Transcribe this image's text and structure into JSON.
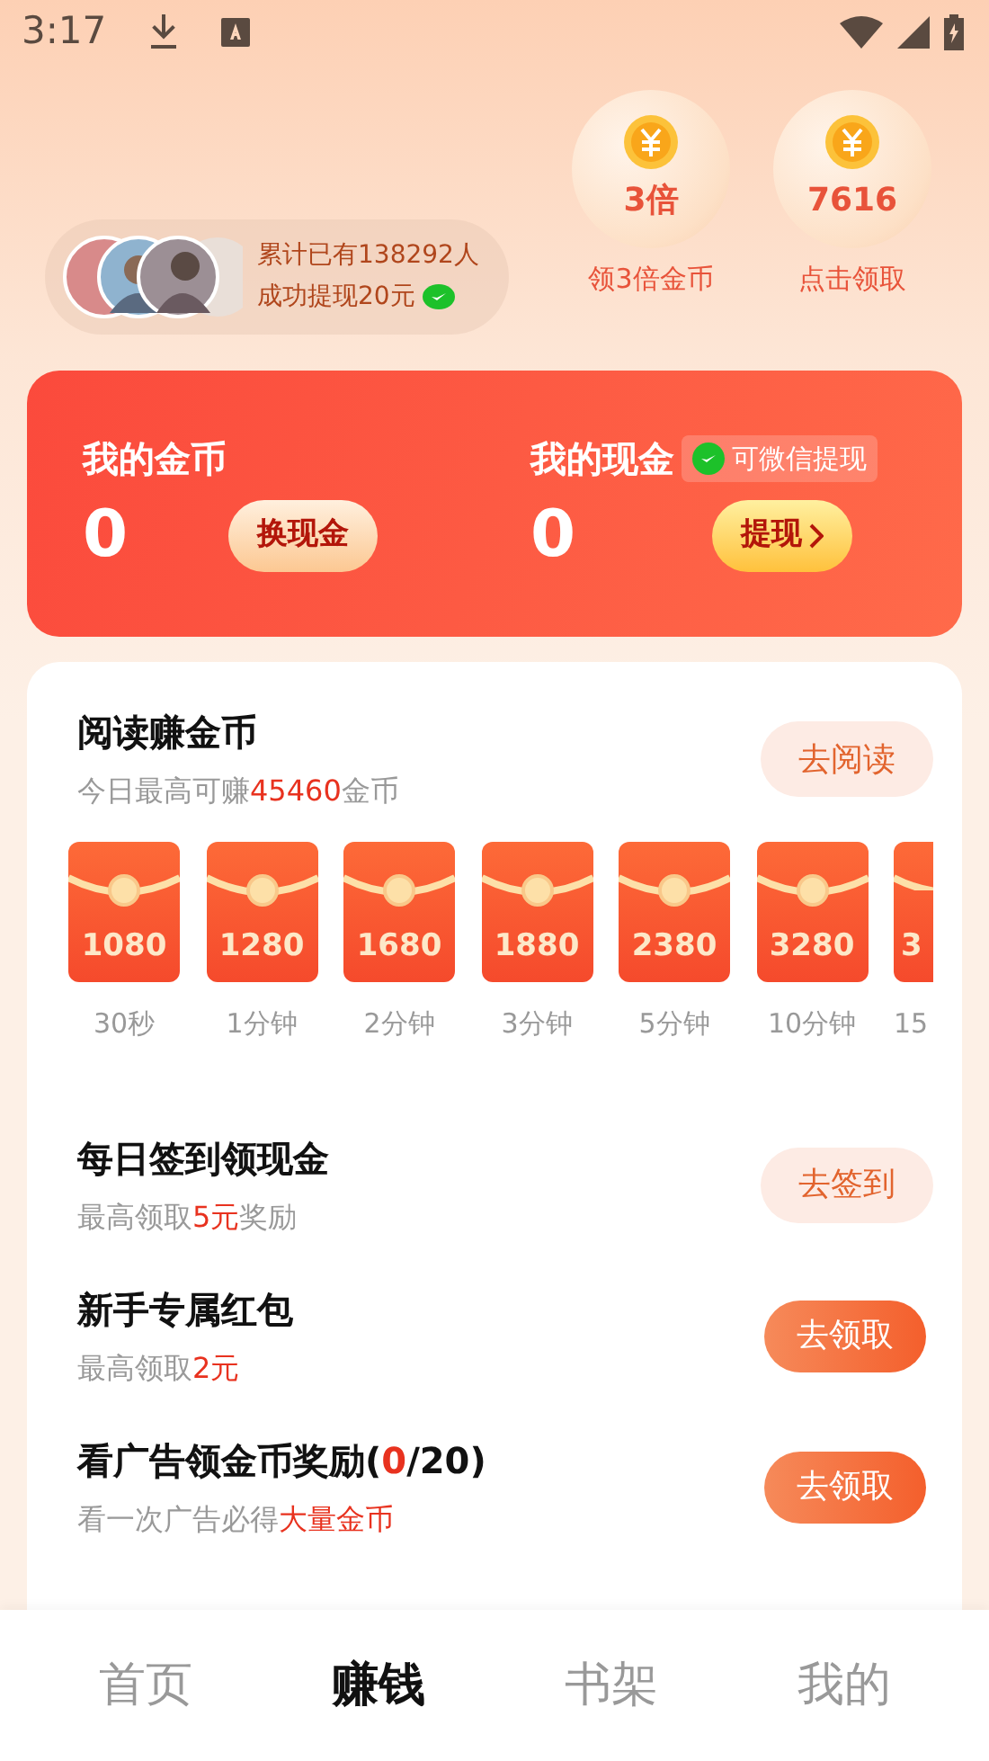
{
  "status_bar": {
    "time": "3:17"
  },
  "withdraw_ticker": {
    "line_1": "累计已有138292人",
    "line_2": "成功提现20元"
  },
  "bubbles": [
    {
      "value": "3倍",
      "label": "领3倍金币"
    },
    {
      "value": "7616",
      "label": "点击领取"
    }
  ],
  "wallet": {
    "coins": {
      "title": "我的金币",
      "amount": "0",
      "button": "换现金"
    },
    "cash": {
      "title": "我的现金",
      "tag": "可微信提现",
      "amount": "0",
      "button": "提现"
    }
  },
  "reading_task": {
    "title": "阅读赚金币",
    "subtitle": "今日最高可赚**45460**金币",
    "button": "去阅读",
    "envelopes": [
      {
        "amount": "1080",
        "time": "30秒"
      },
      {
        "amount": "1280",
        "time": "1分钟"
      },
      {
        "amount": "1680",
        "time": "2分钟"
      },
      {
        "amount": "1880",
        "time": "3分钟"
      },
      {
        "amount": "2380",
        "time": "5分钟"
      },
      {
        "amount": "3280",
        "time": "10分钟"
      },
      {
        "amount": "3",
        "time": "15"
      }
    ]
  },
  "tasks": [
    {
      "title": "每日签到领现金",
      "subtitle": "最高领取**5元**奖励",
      "button": "去签到",
      "kind": "light"
    },
    {
      "title": "新手专属红包",
      "subtitle": "最高领取**2元**",
      "button": "去领取",
      "kind": "filled"
    },
    {
      "title": "看广告领金币奖励(**0**/20)",
      "subtitle": "看一次广告必得**大量金币**",
      "button": "去领取",
      "kind": "filled"
    }
  ],
  "tab_bar": [
    {
      "label": "首页",
      "selected": false
    },
    {
      "label": "赚钱",
      "selected": true
    },
    {
      "label": "书架",
      "selected": false
    },
    {
      "label": "我的",
      "selected": false
    }
  ]
}
